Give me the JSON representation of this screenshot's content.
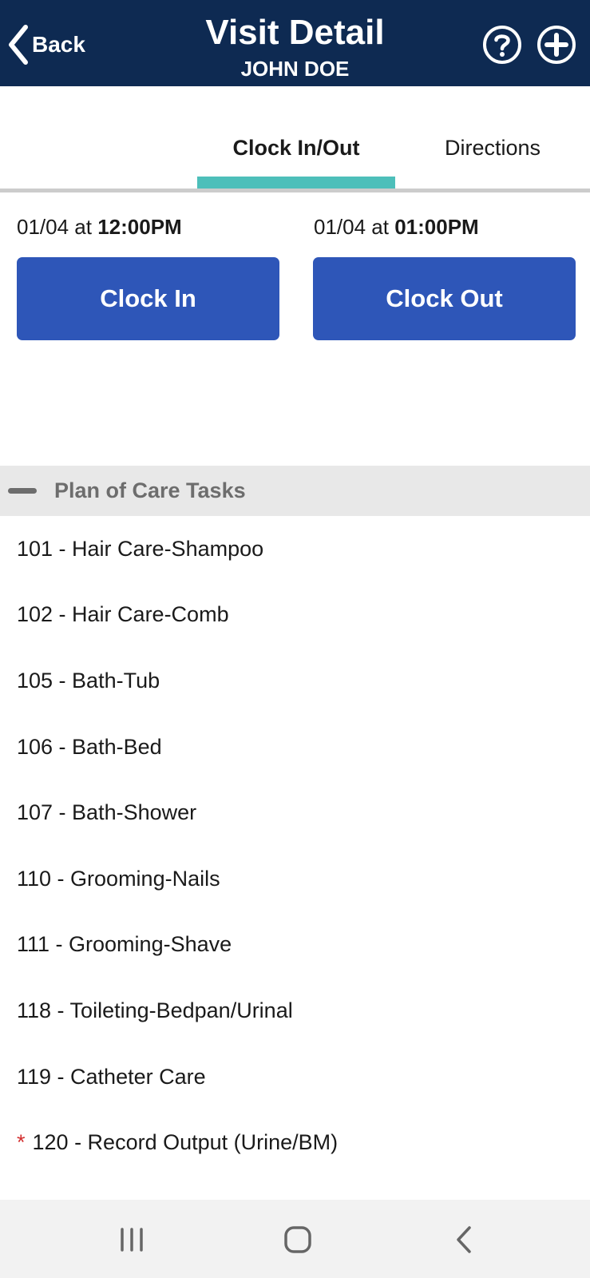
{
  "header": {
    "back_label": "Back",
    "title": "Visit Detail",
    "subtitle": "JOHN DOE",
    "help_icon": "question-circle-icon",
    "add_icon": "plus-circle-icon",
    "background_color": "#0e2a52"
  },
  "tabs": [
    {
      "label": "Clock In/Out",
      "active": true
    },
    {
      "label": "Directions",
      "active": false
    }
  ],
  "tab_indicator_color": "#4dbfba",
  "clock": {
    "in": {
      "date": "01/04",
      "at": " at ",
      "time": "12:00PM",
      "button_label": "Clock In"
    },
    "out": {
      "date": "01/04",
      "at": " at ",
      "time": "01:00PM",
      "button_label": "Clock Out"
    },
    "button_color": "#2e56b8"
  },
  "plan_of_care": {
    "title": "Plan of Care Tasks",
    "expanded": true,
    "tasks": [
      {
        "label": "101 - Hair Care-Shampoo",
        "required": false
      },
      {
        "label": "102 - Hair Care-Comb",
        "required": false
      },
      {
        "label": "105 - Bath-Tub",
        "required": false
      },
      {
        "label": "106 - Bath-Bed",
        "required": false
      },
      {
        "label": "107 - Bath-Shower",
        "required": false
      },
      {
        "label": "110 - Grooming-Nails",
        "required": false
      },
      {
        "label": "111 - Grooming-Shave",
        "required": false
      },
      {
        "label": "118 - Toileting-Bedpan/Urinal",
        "required": false
      },
      {
        "label": "119 - Catheter Care",
        "required": false
      },
      {
        "label": "120 - Record Output (Urine/BM)",
        "required": true
      }
    ],
    "required_marker": "*",
    "required_color": "#d32f2f"
  },
  "nav_bar": {
    "icons": [
      "recent-apps-icon",
      "home-icon",
      "back-icon"
    ]
  }
}
